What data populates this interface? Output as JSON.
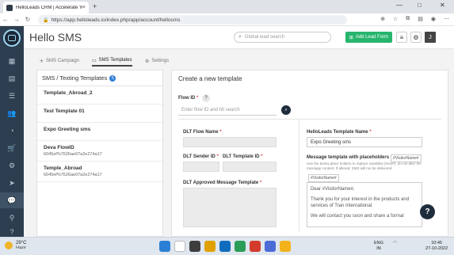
{
  "browser": {
    "tab_title": "HelloLeads CRM | Accelerate Yo...",
    "tab_close": "×",
    "new_tab": "+",
    "url": "https://app.helloleads.io/index.php/app/account/hellosms",
    "win_min": "—",
    "win_max": "□",
    "win_close": "✕"
  },
  "header": {
    "title": "Hello SMS",
    "search_placeholder": "Global lead search",
    "add_lead_label": "Add Lead Form",
    "avatar_initial": "J"
  },
  "tabs": [
    {
      "label": "SMS Campaign",
      "icon": "send-icon"
    },
    {
      "label": "SMS Templates",
      "icon": "template-icon"
    },
    {
      "label": "Settings",
      "icon": "gear-icon"
    }
  ],
  "templates": {
    "heading": "SMS / Texting Templates",
    "count": "5",
    "items": [
      {
        "name": "Template_Abroad_2",
        "sub": ""
      },
      {
        "name": "Test Template 01",
        "sub": ""
      },
      {
        "name": "Expo Greeting sms",
        "sub": ""
      },
      {
        "name": "Deva FlowID",
        "sub": "6045ef%7626ae07a2e274a17"
      },
      {
        "name": "Temple_Abroad",
        "sub": "6045ef%7626ae07a2e274a17"
      }
    ]
  },
  "form": {
    "title": "Create a new template",
    "flow_id_label": "Flow ID",
    "flow_id_placeholder": "Enter flow ID and hit search",
    "dlt_flow_name_label": "DLT Flow Name",
    "dlt_sender_id_label": "DLT Sender ID",
    "dlt_template_id_label": "DLT Template ID",
    "dlt_message_label": "DLT Approved Message Template",
    "hl_template_name_label": "HelloLeads Template Name",
    "hl_template_name_value": "Expo Greeting sms",
    "placeholder_label": "Message template with placeholders",
    "placeholder_chip": "#VisitorName#",
    "placeholder_note": "Use the below place holders to replace variables {#var#}, do not alter the message content. If altered, SMS will not be delivered.",
    "chip2": "#VisitorName#",
    "message_lines": [
      "Dear #VisitorName#,",
      "Thank you for your interest in the products and services of Tran International.",
      "We will  contact you soon and share a formal"
    ],
    "required_mark": "*"
  },
  "help_fab": "?",
  "taskbar": {
    "temp": "29°C",
    "condition": "Haze",
    "lang": "ENG",
    "region": "IN",
    "time": "10:45",
    "date": "27-10-2022"
  }
}
